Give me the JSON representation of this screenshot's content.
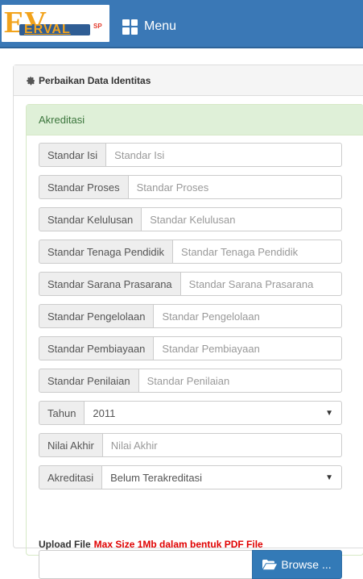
{
  "brand": {
    "logo_letters": "EV",
    "logo_word": "ERVAL",
    "logo_suffix": "SP"
  },
  "navbar": {
    "menu_label": "Menu"
  },
  "panel": {
    "title": "Perbaikan Data Identitas"
  },
  "section": {
    "title": "Akreditasi"
  },
  "fields": [
    {
      "label": "Standar Isi",
      "placeholder": "Standar Isi"
    },
    {
      "label": "Standar Proses",
      "placeholder": "Standar Proses"
    },
    {
      "label": "Standar Kelulusan",
      "placeholder": "Standar Kelulusan"
    },
    {
      "label": "Standar Tenaga Pendidik",
      "placeholder": "Standar Tenaga Pendidik"
    },
    {
      "label": "Standar Sarana Prasarana",
      "placeholder": "Standar Sarana Prasarana"
    },
    {
      "label": "Standar Pengelolaan",
      "placeholder": "Standar Pengelolaan"
    },
    {
      "label": "Standar Pembiayaan",
      "placeholder": "Standar Pembiayaan"
    },
    {
      "label": "Standar Penilaian",
      "placeholder": "Standar Penilaian"
    }
  ],
  "tahun": {
    "label": "Tahun",
    "value": "2011"
  },
  "nilai_akhir": {
    "label": "Nilai Akhir",
    "placeholder": "Nilai Akhir"
  },
  "akreditasi": {
    "label": "Akreditasi",
    "value": "Belum Terakreditasi"
  },
  "upload": {
    "label": "Upload File",
    "warning": "Max Size 1Mb dalam bentuk PDF File",
    "browse_label": "Browse ..."
  },
  "colors": {
    "navbar": "#3a78b6",
    "accent_orange": "#f2a31c",
    "success_bg": "#dff0d8",
    "success_text": "#3c763d",
    "primary_button": "#337ab7",
    "warning_text": "#e00000"
  }
}
